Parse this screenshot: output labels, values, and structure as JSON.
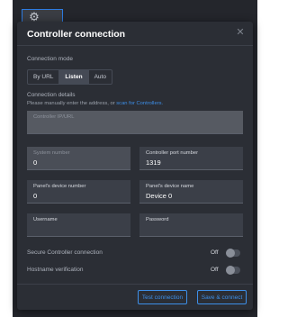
{
  "background": {
    "icon": "gear-icon"
  },
  "dialog": {
    "title": "Controller connection",
    "close_icon": "close-icon"
  },
  "mode": {
    "label": "Connection mode",
    "options": [
      "By URL",
      "Listen",
      "Auto"
    ],
    "selected": "Listen"
  },
  "details": {
    "label": "Connection details",
    "hint_prefix": "Please manually enter the address, or",
    "hint_link": "scan for Controllers."
  },
  "fields": {
    "controller_ip": {
      "label": "Controller IP/URL",
      "value": ""
    },
    "system_number": {
      "label": "System number",
      "value": "0"
    },
    "port": {
      "label": "Controller port number",
      "value": "1319"
    },
    "panel_number": {
      "label": "Panel's device number",
      "value": "0"
    },
    "panel_name": {
      "label": "Panel's device name",
      "value": "Device 0"
    },
    "username": {
      "label": "Username",
      "value": ""
    },
    "password": {
      "label": "Password",
      "value": ""
    }
  },
  "toggles": {
    "secure": {
      "label": "Secure Controller connection",
      "state": "Off"
    },
    "hostname": {
      "label": "Hostname verification",
      "state": "Off"
    }
  },
  "buttons": {
    "test": "Test connection",
    "save": "Save & connect"
  },
  "colors": {
    "accent": "#3d8fe8",
    "dialog_bg": "#2b2e35",
    "field_bg": "#3b3f48"
  }
}
